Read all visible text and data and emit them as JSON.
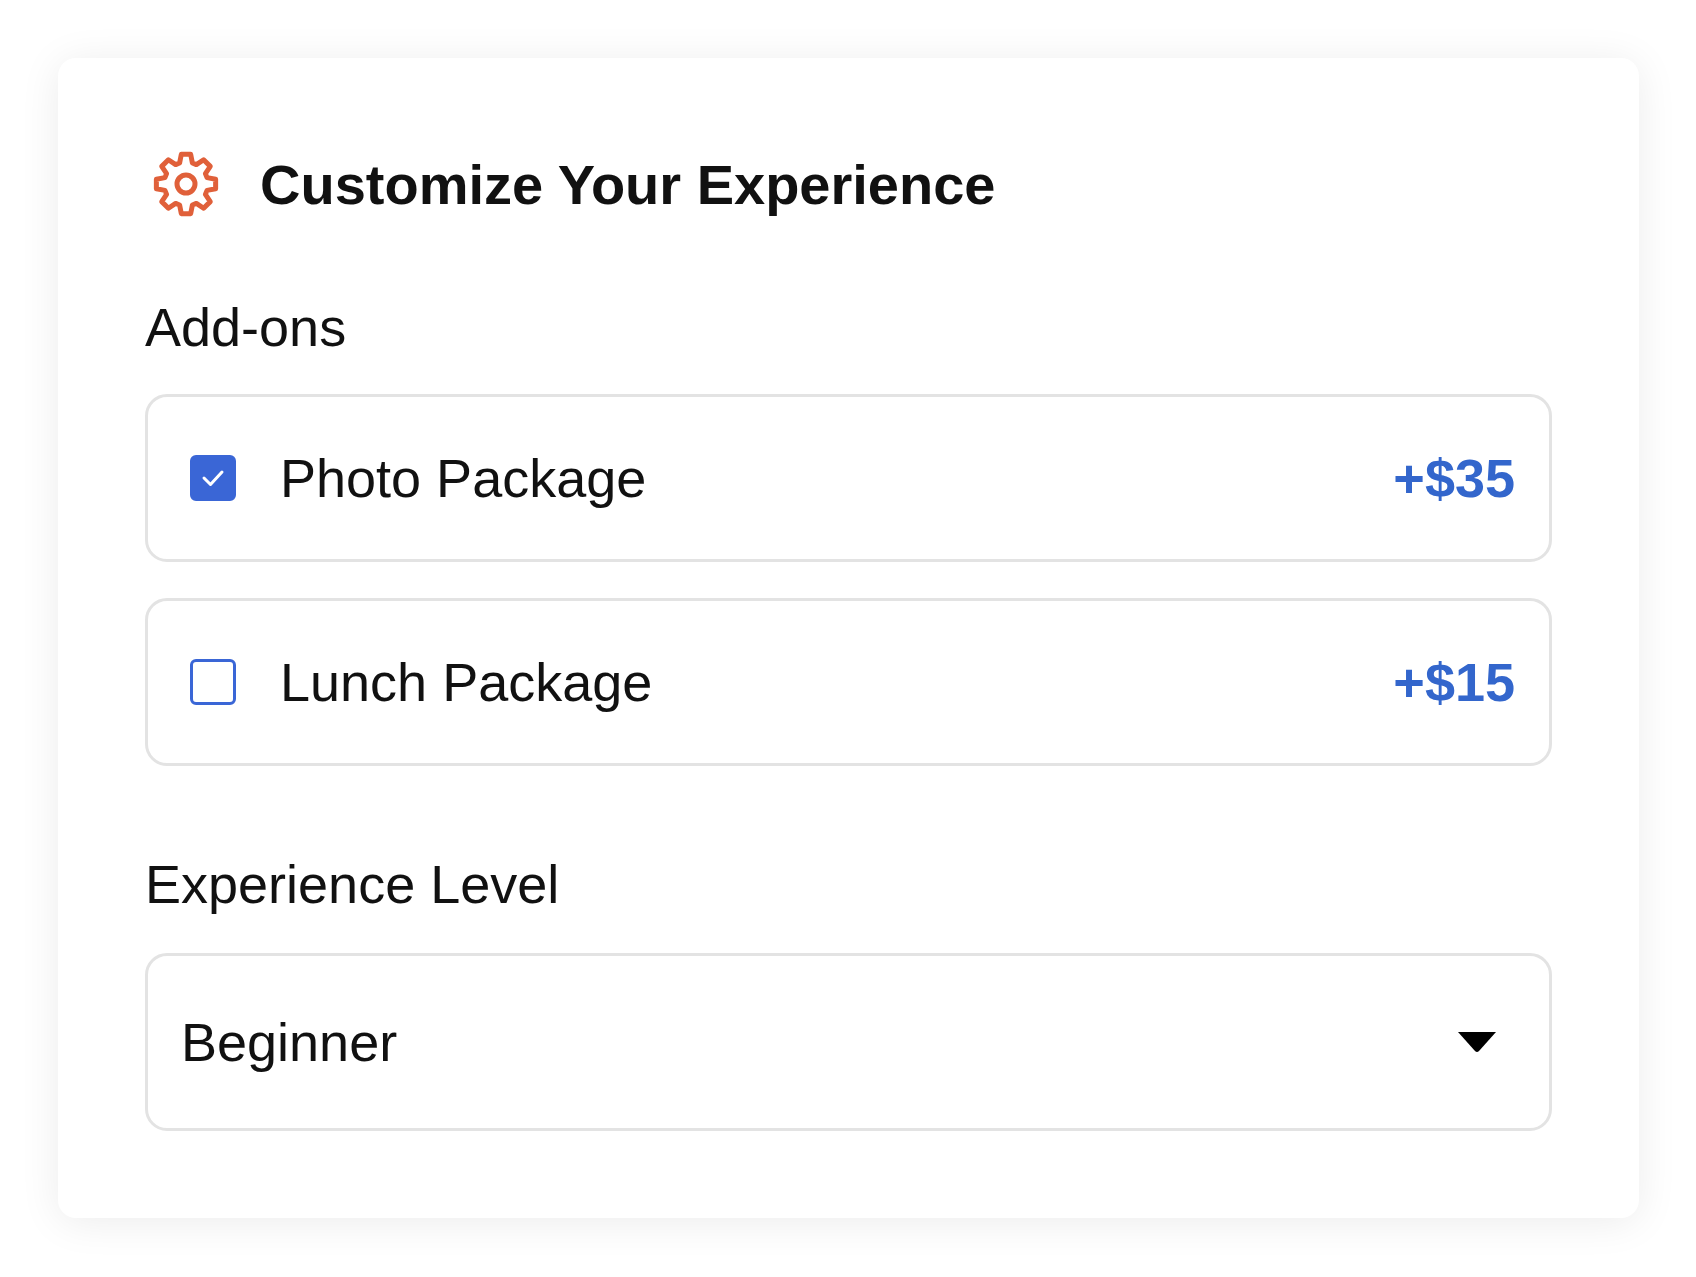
{
  "header": {
    "title": "Customize Your Experience"
  },
  "addons": {
    "label": "Add-ons",
    "options": [
      {
        "name": "Photo Package",
        "price": "+$35",
        "checked": true
      },
      {
        "name": "Lunch Package",
        "price": "+$15",
        "checked": false
      }
    ]
  },
  "experience": {
    "label": "Experience Level",
    "value": "Beginner"
  }
}
